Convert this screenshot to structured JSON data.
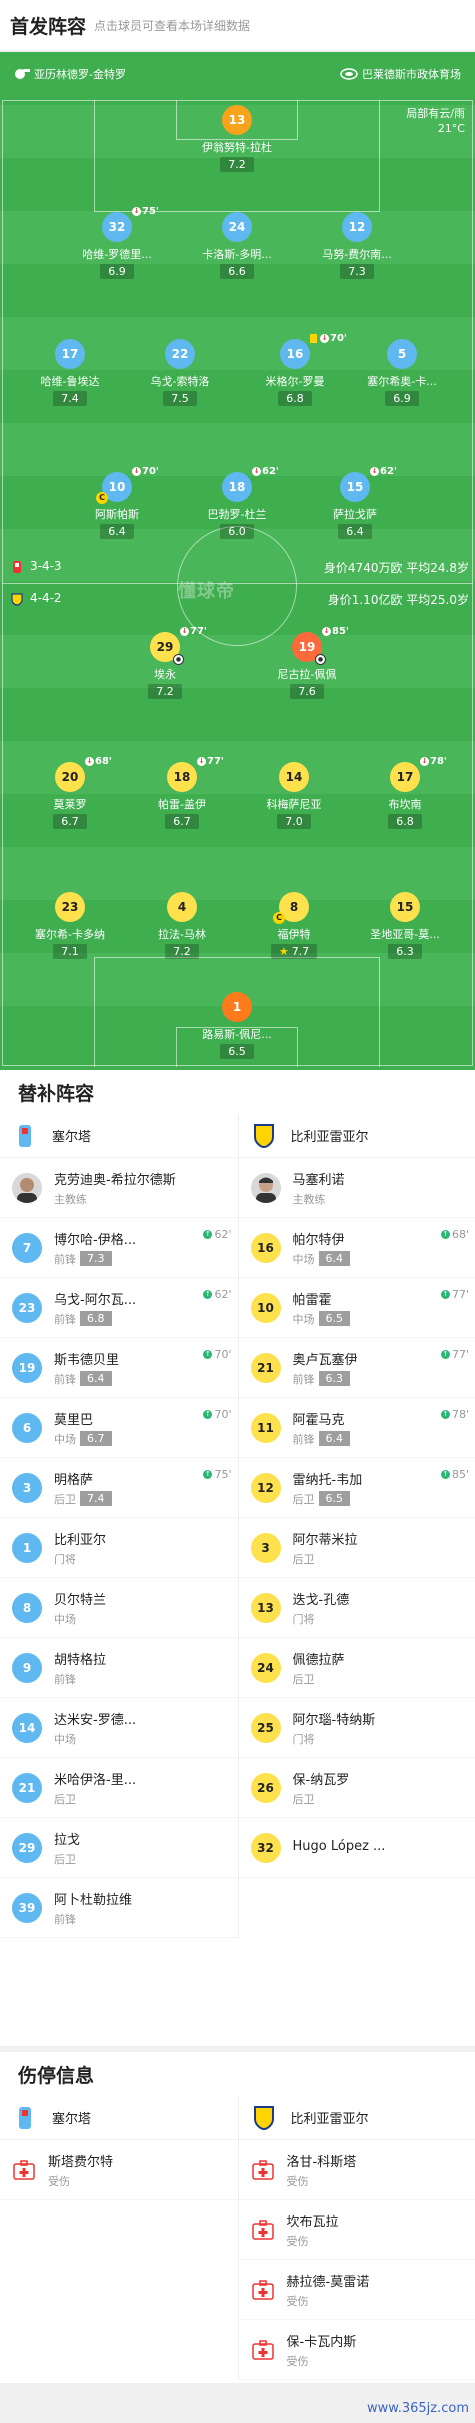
{
  "header": {
    "title": "首发阵容",
    "subtitle": "点击球员可查看本场详细数据"
  },
  "pitch": {
    "home_team": "亚历林德罗-金特罗",
    "venue": "巴莱德斯市政体育场",
    "weather": "局部有云/雨",
    "temp": "21°C",
    "watermark": "懂球帝",
    "home_formation": "3-4-3",
    "home_value": "身价4740万欧 平均24.8岁",
    "away_formation": "4-4-2",
    "away_value": "身价1.10亿欧 平均25.0岁",
    "home": [
      {
        "num": "13",
        "name": "伊翁努特-拉杜",
        "rating": "7.2"
      },
      {
        "num": "32",
        "name": "哈维-罗德里...",
        "rating": "6.9",
        "sub": "75'"
      },
      {
        "num": "24",
        "name": "卡洛斯-多明...",
        "rating": "6.6"
      },
      {
        "num": "12",
        "name": "马努-费尔南...",
        "rating": "7.3"
      },
      {
        "num": "17",
        "name": "哈维-鲁埃达",
        "rating": "7.4"
      },
      {
        "num": "22",
        "name": "乌戈-索特洛",
        "rating": "7.5"
      },
      {
        "num": "16",
        "name": "米格尔-罗曼",
        "rating": "6.8",
        "sub": "70'"
      },
      {
        "num": "5",
        "name": "塞尔希奥-卡...",
        "rating": "6.9"
      },
      {
        "num": "10",
        "name": "阿斯帕斯",
        "rating": "6.4",
        "sub": "70'"
      },
      {
        "num": "18",
        "name": "巴勃罗-杜兰",
        "rating": "6.0",
        "sub": "62'"
      },
      {
        "num": "15",
        "name": "萨拉戈萨",
        "rating": "6.4",
        "sub": "62'"
      }
    ],
    "away": [
      {
        "num": "29",
        "name": "埃永",
        "rating": "7.2",
        "sub": "77'"
      },
      {
        "num": "19",
        "name": "尼古拉-佩佩",
        "rating": "7.6",
        "sub": "85'"
      },
      {
        "num": "20",
        "name": "莫莱罗",
        "rating": "6.7",
        "sub": "68'"
      },
      {
        "num": "18",
        "name": "帕雷-盖伊",
        "rating": "6.7",
        "sub": "77'"
      },
      {
        "num": "14",
        "name": "科梅萨尼亚",
        "rating": "7.0"
      },
      {
        "num": "17",
        "name": "布坎南",
        "rating": "6.8",
        "sub": "78'"
      },
      {
        "num": "23",
        "name": "塞尔希-卡多纳",
        "rating": "7.1"
      },
      {
        "num": "4",
        "name": "拉法-马林",
        "rating": "7.2"
      },
      {
        "num": "8",
        "name": "福伊特",
        "rating": "7.7"
      },
      {
        "num": "15",
        "name": "圣地亚哥-莫...",
        "rating": "6.3"
      },
      {
        "num": "1",
        "name": "路易斯-佩尼...",
        "rating": "6.5"
      }
    ]
  },
  "subs": {
    "title": "替补阵容",
    "home_team": "塞尔塔",
    "away_team": "比利亚雷亚尔",
    "home_coach": {
      "name": "克劳迪奥-希拉尔德斯",
      "role": "主教练"
    },
    "away_coach": {
      "name": "马塞利诺",
      "role": "主教练"
    },
    "home": [
      {
        "num": "7",
        "name": "博尔哈-伊格...",
        "pos": "前锋",
        "rating": "7.3",
        "min": "62'"
      },
      {
        "num": "23",
        "name": "乌戈-阿尔瓦...",
        "pos": "前锋",
        "rating": "6.8",
        "min": "62'"
      },
      {
        "num": "19",
        "name": "斯韦德贝里",
        "pos": "前锋",
        "rating": "6.4",
        "min": "70'"
      },
      {
        "num": "6",
        "name": "莫里巴",
        "pos": "中场",
        "rating": "6.7",
        "min": "70'"
      },
      {
        "num": "3",
        "name": "明格萨",
        "pos": "后卫",
        "rating": "7.4",
        "min": "75'"
      },
      {
        "num": "1",
        "name": "比利亚尔",
        "pos": "门将"
      },
      {
        "num": "8",
        "name": "贝尔特兰",
        "pos": "中场"
      },
      {
        "num": "9",
        "name": "胡特格拉",
        "pos": "前锋"
      },
      {
        "num": "14",
        "name": "达米安-罗德...",
        "pos": "中场"
      },
      {
        "num": "21",
        "name": "米哈伊洛-里...",
        "pos": "后卫"
      },
      {
        "num": "29",
        "name": "拉戈",
        "pos": "后卫"
      },
      {
        "num": "39",
        "name": "阿卜杜勒拉维",
        "pos": "前锋"
      }
    ],
    "away": [
      {
        "num": "16",
        "name": "帕尔特伊",
        "pos": "中场",
        "rating": "6.4",
        "min": "68'"
      },
      {
        "num": "10",
        "name": "帕雷霍",
        "pos": "中场",
        "rating": "6.5",
        "min": "77'"
      },
      {
        "num": "21",
        "name": "奥卢瓦塞伊",
        "pos": "前锋",
        "rating": "6.3",
        "min": "77'"
      },
      {
        "num": "11",
        "name": "阿霍马克",
        "pos": "前锋",
        "rating": "6.4",
        "min": "78'"
      },
      {
        "num": "12",
        "name": "雷纳托-韦加",
        "pos": "后卫",
        "rating": "6.5",
        "min": "85'"
      },
      {
        "num": "3",
        "name": "阿尔蒂米拉",
        "pos": "后卫"
      },
      {
        "num": "13",
        "name": "迭戈-孔德",
        "pos": "门将"
      },
      {
        "num": "24",
        "name": "佩德拉萨",
        "pos": "后卫"
      },
      {
        "num": "25",
        "name": "阿尔瑙-特纳斯",
        "pos": "门将"
      },
      {
        "num": "26",
        "name": "保-纳瓦罗",
        "pos": "后卫"
      },
      {
        "num": "32",
        "name": "Hugo López ...",
        "pos": ""
      }
    ]
  },
  "injuries": {
    "title": "伤停信息",
    "home_team": "塞尔塔",
    "away_team": "比利亚雷亚尔",
    "home": [
      {
        "name": "斯塔费尔特",
        "status": "受伤"
      }
    ],
    "away": [
      {
        "name": "洛甘-科斯塔",
        "status": "受伤"
      },
      {
        "name": "坎布瓦拉",
        "status": "受伤"
      },
      {
        "name": "赫拉德-莫雷诺",
        "status": "受伤"
      },
      {
        "name": "保-卡瓦内斯",
        "status": "受伤"
      }
    ]
  },
  "footer": {
    "url": "www.365jz.com"
  }
}
